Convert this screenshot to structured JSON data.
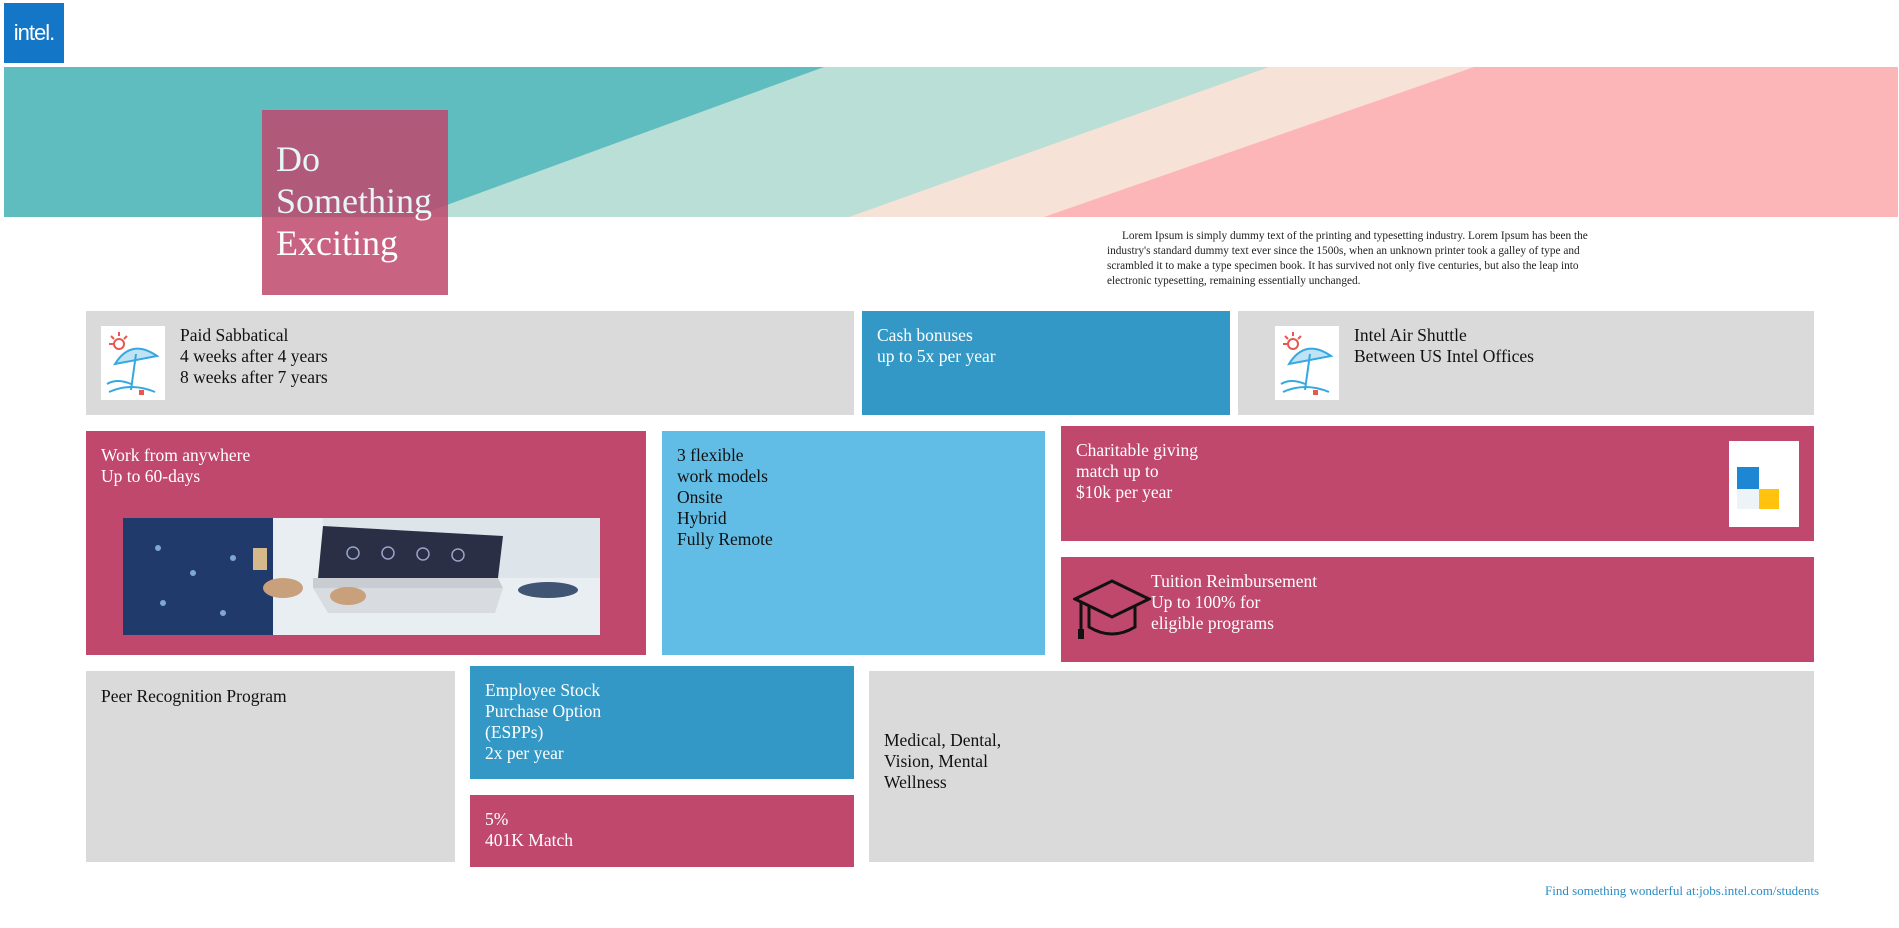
{
  "logo": {
    "text": "intel.",
    "brand_color": "#1476c6"
  },
  "headline": {
    "lines": [
      "Do",
      "Something",
      "Exciting"
    ],
    "color": "#c0486d"
  },
  "intro": {
    "text": "Lorem Ipsum is simply dummy text of the printing and typesetting industry. Lorem Ipsum has been the industry's standard dummy text ever since the 1500s, when an unknown printer took a galley of type and scrambled it to make a type specimen book. It has survived not only five centuries, but also the leap into electronic typesetting, remaining essentially unchanged."
  },
  "tiles": {
    "sabbatical": {
      "lines": [
        "Paid Sabbatical",
        "4 weeks after 4 years",
        "8 weeks after 7 years"
      ],
      "icon": "beach-umbrella-icon"
    },
    "cash": {
      "lines": [
        "Cash bonuses",
        "up to 5x per year"
      ]
    },
    "shuttle": {
      "lines": [
        "Intel Air Shuttle",
        "Between US Intel Offices"
      ],
      "icon": "beach-umbrella-icon"
    },
    "work_anywhere": {
      "lines": [
        "Work from anywhere",
        "Up to 60-days"
      ],
      "image": "person-on-laptop-photo"
    },
    "flexible": {
      "lines": [
        "3 flexible",
        "work models",
        "Onsite",
        "Hybrid",
        "Fully Remote"
      ]
    },
    "charitable": {
      "lines": [
        "Charitable giving",
        "match up to",
        "$10k per year"
      ],
      "icon": "squares-icon"
    },
    "tuition": {
      "lines": [
        "Tuition Reimbursement",
        "Up to 100% for",
        "eligible programs"
      ],
      "icon": "graduation-cap-icon"
    },
    "peer": {
      "lines": [
        "Peer Recognition Program"
      ]
    },
    "espp": {
      "lines": [
        "Employee Stock",
        "Purchase Option",
        "(ESPPs)",
        "2x per year"
      ]
    },
    "match401k": {
      "lines": [
        "5%",
        "401K Match"
      ]
    },
    "medical": {
      "lines": [
        "Medical, Dental,",
        "Vision, Mental",
        "Wellness"
      ]
    }
  },
  "footer": {
    "text": "Find something wonderful at:jobs.intel.com/students"
  },
  "colors": {
    "grey": "#dadada",
    "blue": "#3398c5",
    "light_blue": "#61bde5",
    "pink": "#c0486d",
    "teal": "#5fbdbf",
    "mint": "#badfd6",
    "peach": "#f7e2d8",
    "salmon": "#fdb6b7"
  }
}
